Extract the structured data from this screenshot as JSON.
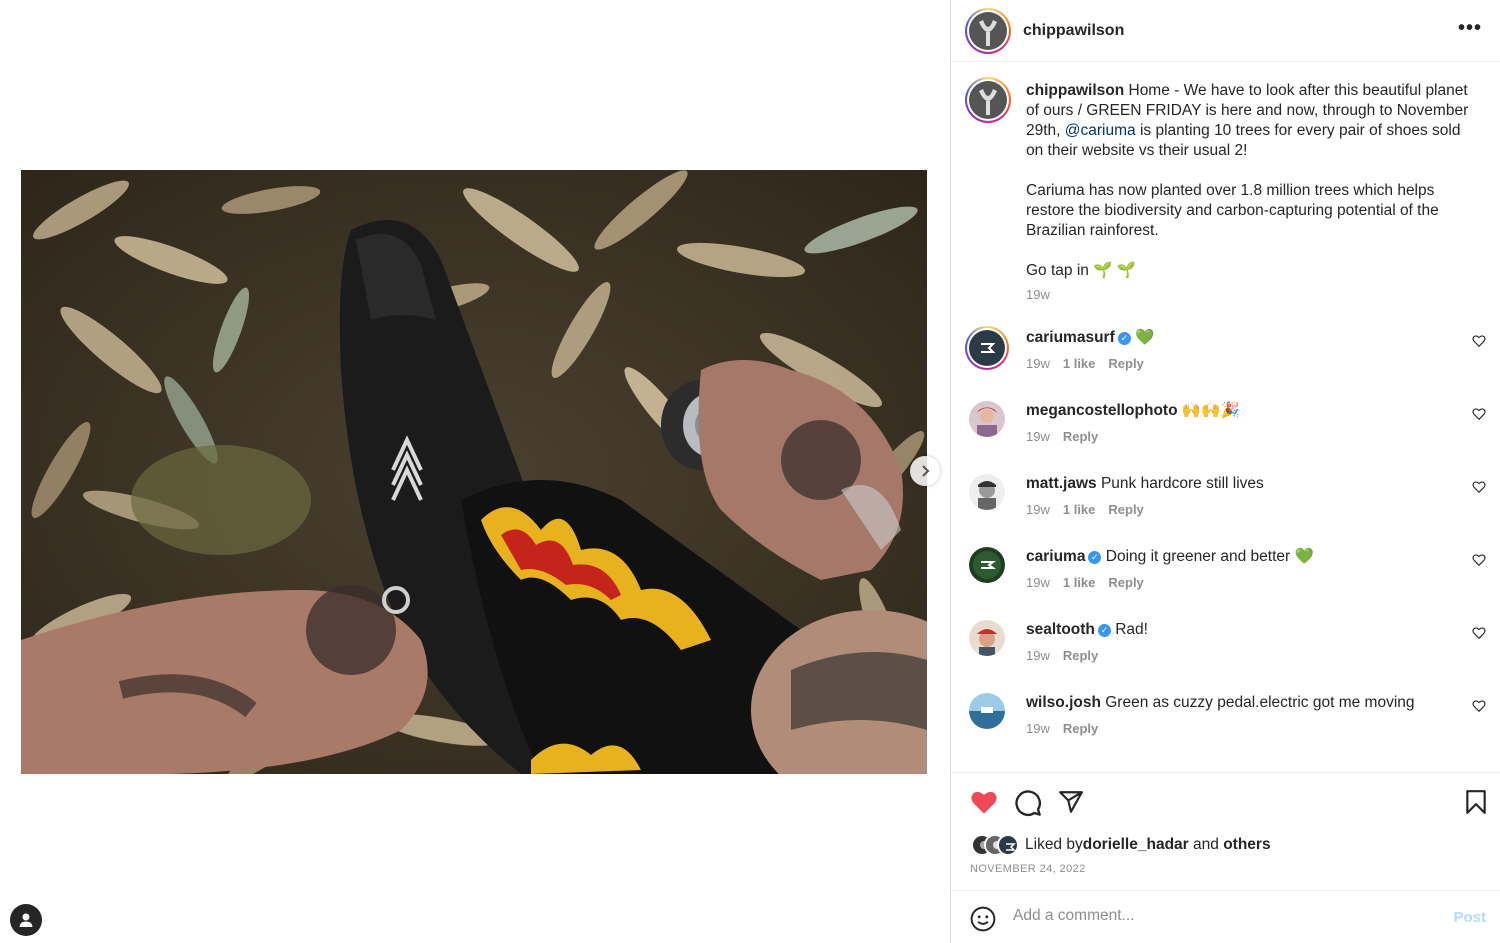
{
  "post": {
    "author": "chippawilson",
    "more_label": "•••",
    "caption": {
      "username": "chippawilson",
      "text_before_mention": " Home - We have to look after this beautiful planet of ours / GREEN FRIDAY is here and now, through to November 29th, ",
      "mention": "@cariuma",
      "text_after_mention": " is planting 10 trees for every pair of shoes sold on their website vs their usual 2!\n\nCariuma has now planted over 1.8 million trees which helps restore the biodiversity and carbon-capturing potential of the Brazilian rainforest.\n\nGo tap in 🌱 🌱",
      "time": "19w"
    },
    "comments": [
      {
        "username": "cariumasurf",
        "verified": true,
        "text": " 💚",
        "time": "19w",
        "likes": "1 like",
        "reply": "Reply"
      },
      {
        "username": "megancostellophoto",
        "verified": false,
        "text": " 🙌🙌🎉",
        "time": "19w",
        "likes": "",
        "reply": "Reply"
      },
      {
        "username": "matt.jaws",
        "verified": false,
        "text": " Punk hardcore still lives",
        "time": "19w",
        "likes": "1 like",
        "reply": "Reply"
      },
      {
        "username": "cariuma",
        "verified": true,
        "text": " Doing it greener and better 💚",
        "time": "19w",
        "likes": "1 like",
        "reply": "Reply"
      },
      {
        "username": "sealtooth",
        "verified": true,
        "text": " Rad!",
        "time": "19w",
        "likes": "",
        "reply": "Reply"
      },
      {
        "username": "wilso.josh",
        "verified": false,
        "text": " Green as cuzzy pedal.electric got me moving",
        "time": "19w",
        "likes": "",
        "reply": "Reply"
      }
    ],
    "likes": {
      "prefix": "Liked by ",
      "liker": "dorielle_hadar",
      "middle": " and ",
      "others": "others"
    },
    "date": "NOVEMBER 24, 2022",
    "add_comment": {
      "placeholder": "Add a comment...",
      "post_label": "Post"
    }
  },
  "colors": {
    "liked_heart": "#ed4956",
    "mention": "#00376b",
    "verified": "#3897f0",
    "post_disabled": "#b3dbff"
  }
}
